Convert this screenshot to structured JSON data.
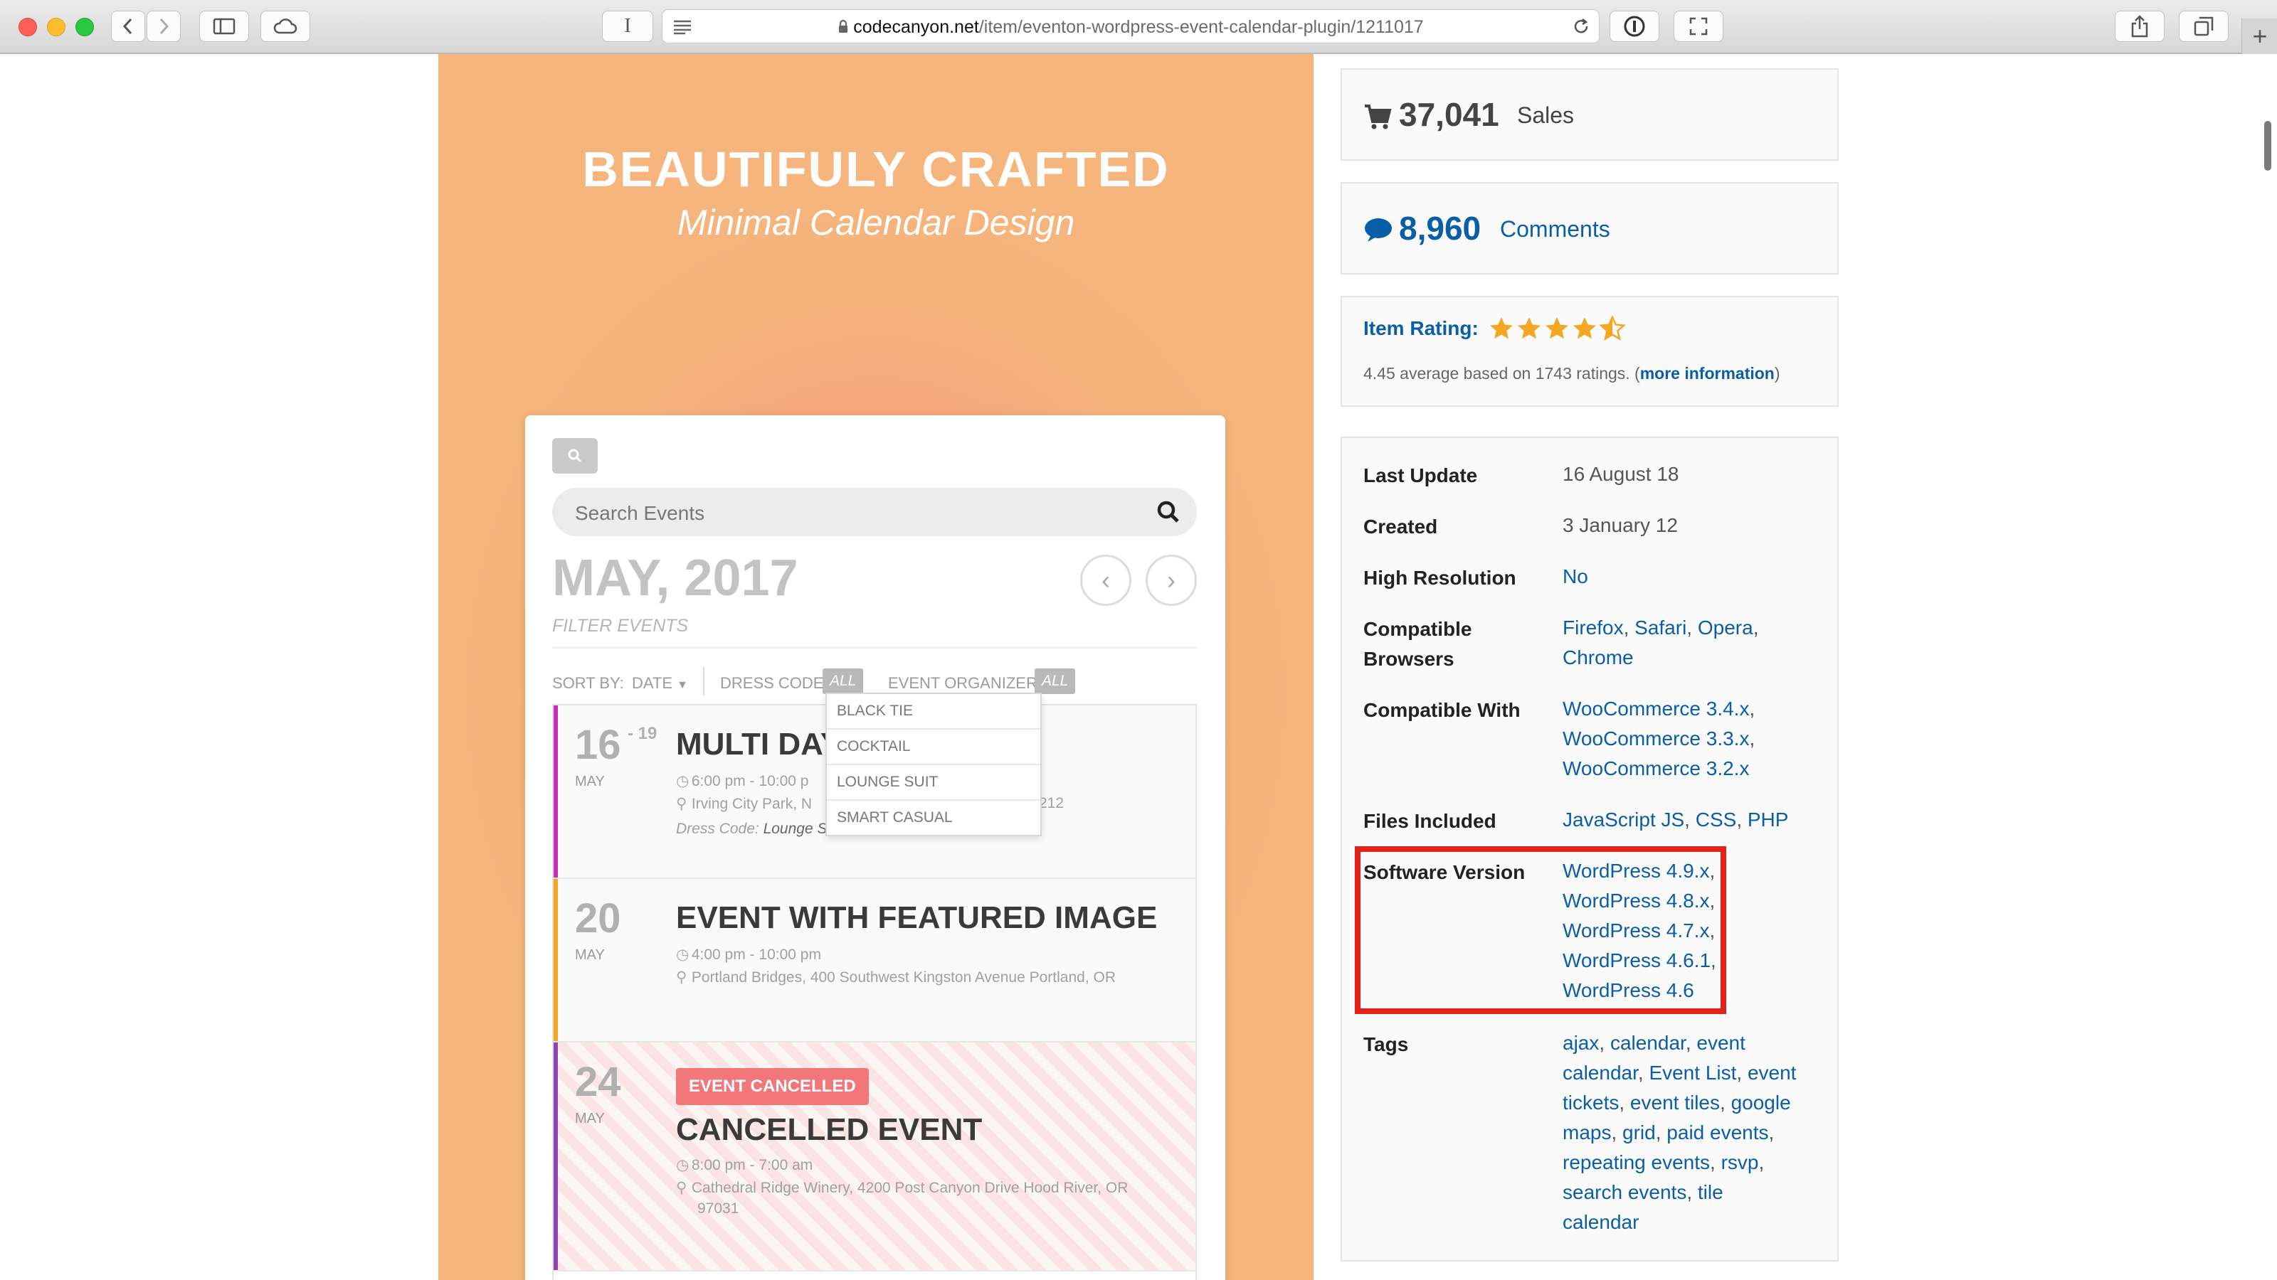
{
  "browser": {
    "url_domain": "codecanyon.net",
    "url_path": "/item/eventon-wordpress-event-calendar-plugin/1211017",
    "new_tab": "+",
    "reader_icon": "I"
  },
  "hero": {
    "title": "BEAUTIFULY CRAFTED",
    "subtitle": "Minimal Calendar Design"
  },
  "calendar": {
    "search_placeholder": "Search Events",
    "month": "MAY, 2017",
    "filter_label": "FILTER EVENTS",
    "sort_by": "SORT BY:",
    "sort_value": "DATE",
    "dress_code": "DRESS CODE:",
    "dress_badge": "ALL",
    "organizer": "EVENT ORGANIZER:",
    "organizer_badge": "ALL",
    "dress_options": [
      "BLACK TIE",
      "COCKTAIL",
      "LOUNGE SUIT",
      "SMART CASUAL"
    ],
    "events": [
      {
        "day": "16",
        "day_end": "- 19",
        "month": "MAY",
        "title": "MULTI DAY",
        "time": "6:00 pm - 10:00 p",
        "location": "Irving City Park, N",
        "location_tail": "212",
        "dress_label": "Dress Code:",
        "dress_value": "Lounge S",
        "color": "#c62fb8"
      },
      {
        "day": "20",
        "month": "MAY",
        "title": "EVENT WITH FEATURED IMAGE",
        "time": "4:00 pm - 10:00 pm",
        "location": "Portland Bridges, 400 Southwest Kingston Avenue Portland, OR",
        "color": "#f5a623"
      },
      {
        "day": "24",
        "month": "MAY",
        "badge": "EVENT CANCELLED",
        "title": "CANCELLED EVENT",
        "time": "8:00 pm - 7:00 am",
        "location_line1": "Cathedral Ridge Winery, 4200 Post Canyon Drive Hood River, OR",
        "location_line2": "97031",
        "color": "#8e44ad"
      }
    ]
  },
  "sidebar": {
    "sales_count": "37,041",
    "sales_label": "Sales",
    "comments_count": "8,960",
    "comments_label": "Comments",
    "rating_label": "Item Rating:",
    "rating_value": 4.45,
    "rating_text": "4.45 average based on 1743 ratings. (",
    "rating_link": "more information",
    "rating_close": ")",
    "info": {
      "last_update_label": "Last Update",
      "last_update": "16 August 18",
      "created_label": "Created",
      "created": "3 January 12",
      "high_res_label": "High Resolution",
      "high_res": "No",
      "browsers_label_1": "Compatible",
      "browsers_label_2": "Browsers",
      "browsers_line1": [
        "Firefox",
        "Safari",
        "Opera"
      ],
      "browsers_line2": "Chrome",
      "compatible_with_label": "Compatible With",
      "compatible_with": [
        "WooCommerce 3.4.x",
        "WooCommerce 3.3.x",
        "WooCommerce 3.2.x"
      ],
      "files_label": "Files Included",
      "files": [
        "JavaScript JS",
        "CSS",
        "PHP"
      ],
      "software_label": "Software Version",
      "software": [
        "WordPress 4.9.x",
        "WordPress 4.8.x",
        "WordPress 4.7.x",
        "WordPress 4.6.1",
        "WordPress 4.6"
      ],
      "tags_label": "Tags",
      "tags_lines": [
        [
          "ajax",
          "calendar",
          "event"
        ],
        [
          "calendar",
          "Event List",
          "event"
        ],
        [
          "tickets",
          "event tiles",
          "google"
        ],
        [
          "maps",
          "grid",
          "paid events"
        ],
        [
          "repeating events",
          "rsvp"
        ],
        [
          "search events",
          "tile"
        ],
        [
          "calendar"
        ]
      ]
    }
  },
  "colors": {
    "link": "#0a5ea8",
    "highlight": "#e2231a",
    "star": "#f5a623"
  }
}
